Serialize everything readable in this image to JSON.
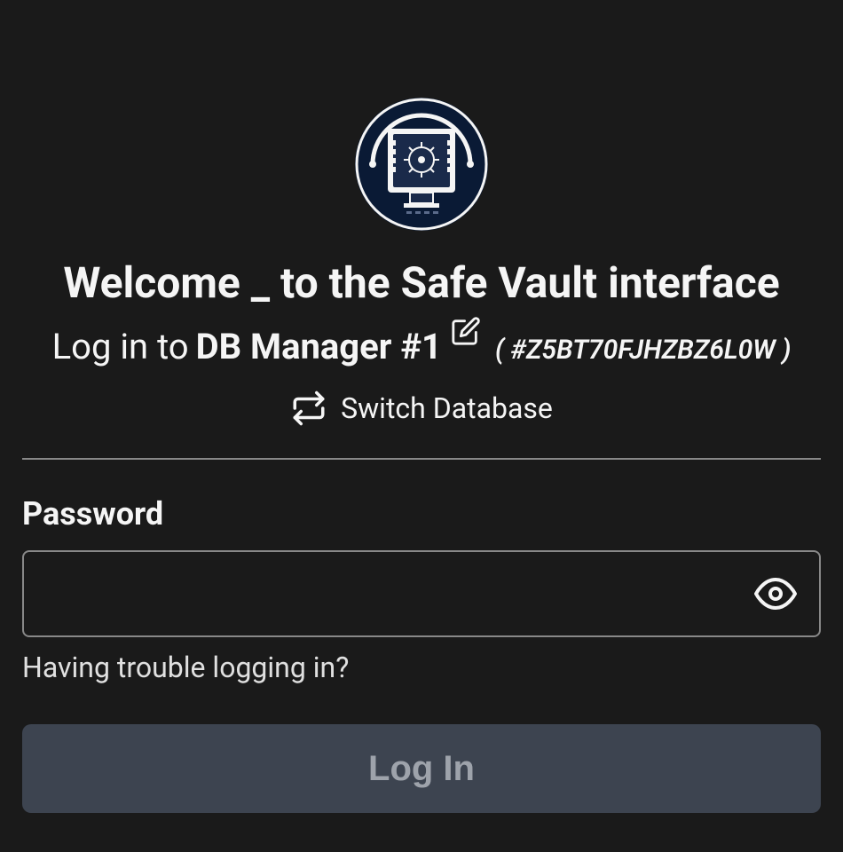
{
  "header": {
    "welcome_title": "Welcome _ to the Safe Vault interface",
    "login_prefix": "Log in to ",
    "db_name": "DB Manager #1",
    "db_id": "( #Z5BT70FJHZBZ6L0W )",
    "switch_db_label": "Switch Database"
  },
  "form": {
    "password_label": "Password",
    "password_value": "",
    "password_placeholder": "",
    "trouble_link": "Having trouble logging in?",
    "login_button_label": "Log In"
  },
  "icons": {
    "edit": "edit-icon",
    "switch": "switch-icon",
    "eye": "eye-icon"
  },
  "colors": {
    "background": "#1a1a1a",
    "text": "#f5f5f5",
    "button_bg": "#3d4450",
    "button_text": "#9ea3ab",
    "border": "#888"
  }
}
